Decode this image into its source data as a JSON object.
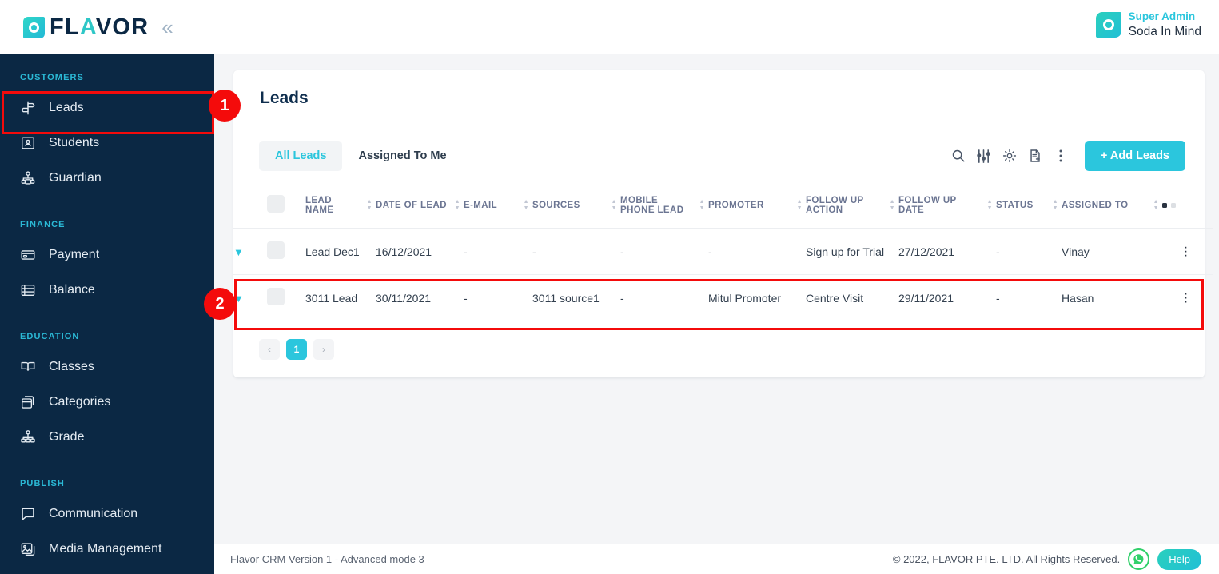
{
  "brand": {
    "name_prefix": "FL",
    "name_mid": "AVOR",
    "collapse_icon": "chevron-double-left"
  },
  "user": {
    "role": "Super Admin",
    "name": "Soda In Mind"
  },
  "sidebar": {
    "sections": [
      {
        "title": "CUSTOMERS",
        "items": [
          {
            "label": "Leads",
            "icon": "signpost-icon",
            "active": true
          },
          {
            "label": "Students",
            "icon": "id-card-icon",
            "active": false
          },
          {
            "label": "Guardian",
            "icon": "guardian-icon",
            "active": false
          }
        ]
      },
      {
        "title": "FINANCE",
        "items": [
          {
            "label": "Payment",
            "icon": "credit-card-icon",
            "active": false
          },
          {
            "label": "Balance",
            "icon": "coins-icon",
            "active": false
          }
        ]
      },
      {
        "title": "EDUCATION",
        "items": [
          {
            "label": "Classes",
            "icon": "book-icon",
            "active": false
          },
          {
            "label": "Categories",
            "icon": "boxes-icon",
            "active": false
          },
          {
            "label": "Grade",
            "icon": "hierarchy-icon",
            "active": false
          }
        ]
      },
      {
        "title": "PUBLISH",
        "items": [
          {
            "label": "Communication",
            "icon": "chat-bubble-icon",
            "active": false
          },
          {
            "label": "Media Management",
            "icon": "image-stack-icon",
            "active": false
          }
        ]
      }
    ]
  },
  "page": {
    "title": "Leads"
  },
  "toolbar": {
    "tabs": [
      {
        "label": "All Leads",
        "active": true
      },
      {
        "label": "Assigned To Me",
        "active": false
      }
    ],
    "icons": [
      {
        "name": "search-icon",
        "glyph": "search"
      },
      {
        "name": "filter-sliders-icon",
        "glyph": "sliders"
      },
      {
        "name": "gear-icon",
        "glyph": "gear"
      },
      {
        "name": "document-add-icon",
        "glyph": "doc"
      },
      {
        "name": "more-vertical-icon",
        "glyph": "kebab"
      }
    ],
    "add_button": "+ Add Leads"
  },
  "table": {
    "columns": [
      "LEAD NAME",
      "DATE OF LEAD",
      "E-MAIL",
      "SOURCES",
      "MOBILE PHONE LEAD",
      "PROMOTER",
      "FOLLOW UP ACTION",
      "FOLLOW UP DATE",
      "STATUS",
      "ASSIGNED TO"
    ],
    "rows": [
      {
        "lead_name": "Lead Dec1",
        "date_of_lead": "16/12/2021",
        "email": "-",
        "sources": "-",
        "mobile_phone_lead": "-",
        "promoter": "-",
        "follow_up_action": "Sign up for Trial",
        "follow_up_date": "27/12/2021",
        "status": "-",
        "assigned_to": "Vinay"
      },
      {
        "lead_name": "3011 Lead",
        "date_of_lead": "30/11/2021",
        "email": "-",
        "sources": "3011 source1",
        "mobile_phone_lead": "-",
        "promoter": "Mitul Promoter",
        "follow_up_action": "Centre Visit",
        "follow_up_date": "29/11/2021",
        "status": "-",
        "assigned_to": "Hasan"
      }
    ]
  },
  "pagination": {
    "prev": "‹",
    "current": "1",
    "next": "›"
  },
  "footer": {
    "version": "Flavor CRM Version 1 - Advanced mode 3",
    "copyright": "© 2022, FLAVOR PTE. LTD. All Rights Reserved.",
    "help_label": "Help"
  },
  "annotations": [
    {
      "number": "1",
      "target": "sidebar-item-leads"
    },
    {
      "number": "2",
      "target": "table-row-1"
    }
  ],
  "colors": {
    "accent": "#2bc6dd",
    "sidebar_bg": "#0b2844",
    "annotation_red": "#f40b0b",
    "page_bg": "#f4f5f7"
  }
}
